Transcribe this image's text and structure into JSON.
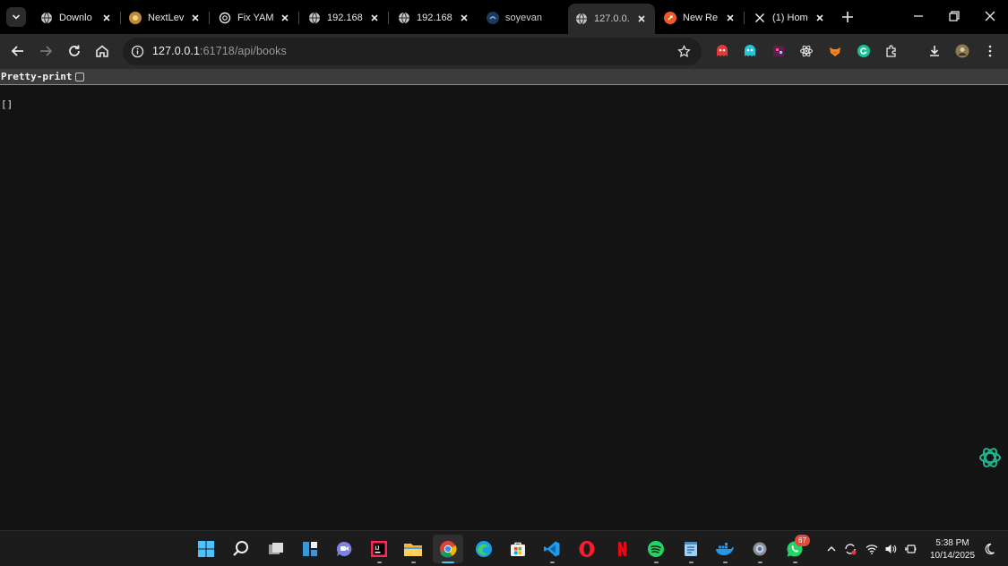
{
  "browser": {
    "tabs": [
      {
        "title": "Downlo",
        "favicon": "globe-icon",
        "active": false
      },
      {
        "title": "NextLev",
        "favicon": "nextlevel-icon",
        "active": false
      },
      {
        "title": "Fix YAM",
        "favicon": "openai-icon",
        "active": false
      },
      {
        "title": "192.168",
        "favicon": "globe-icon",
        "active": false
      },
      {
        "title": "192.168",
        "favicon": "globe-icon",
        "active": false
      },
      {
        "title": "soyevan",
        "favicon": "soyevan-icon",
        "active": false
      },
      {
        "title": "127.0.0.",
        "favicon": "globe-icon",
        "active": true
      },
      {
        "title": "New Re",
        "favicon": "postman-icon",
        "active": false
      },
      {
        "title": "(1) Hom",
        "favicon": "x-icon",
        "active": false
      }
    ],
    "address": {
      "host": "127.0.0.1",
      "path": ":61718/api/books"
    },
    "extensions": [
      "ghost-red-extension-icon",
      "ghost-cyan-extension-icon",
      "game-extension-icon",
      "react-extension-icon",
      "metamask-extension-icon",
      "grammarly-extension-icon",
      "puzzle-extension-icon"
    ]
  },
  "page": {
    "pretty_print_label": "Pretty-print",
    "pretty_print_checked": false,
    "json_text": "[]"
  },
  "taskbar": {
    "apps": [
      "windows-start-icon",
      "search-icon",
      "task-view-icon",
      "widgets-icon",
      "teams-chat-icon",
      "intellij-icon",
      "file-explorer-icon",
      "chrome-icon",
      "edge-icon",
      "microsoft-store-icon",
      "vscode-icon",
      "opera-icon",
      "netflix-icon",
      "spotify-icon",
      "notepad-icon",
      "docker-icon",
      "settings-icon",
      "whatsapp-icon"
    ],
    "whatsapp_badge": "67",
    "time": "5:38 PM",
    "date": "10/14/2025"
  },
  "colors": {
    "tab_strip": "#000000",
    "toolbar": "#2a2a2a",
    "page_background": "#131313",
    "accent": "#4cc2ff"
  }
}
